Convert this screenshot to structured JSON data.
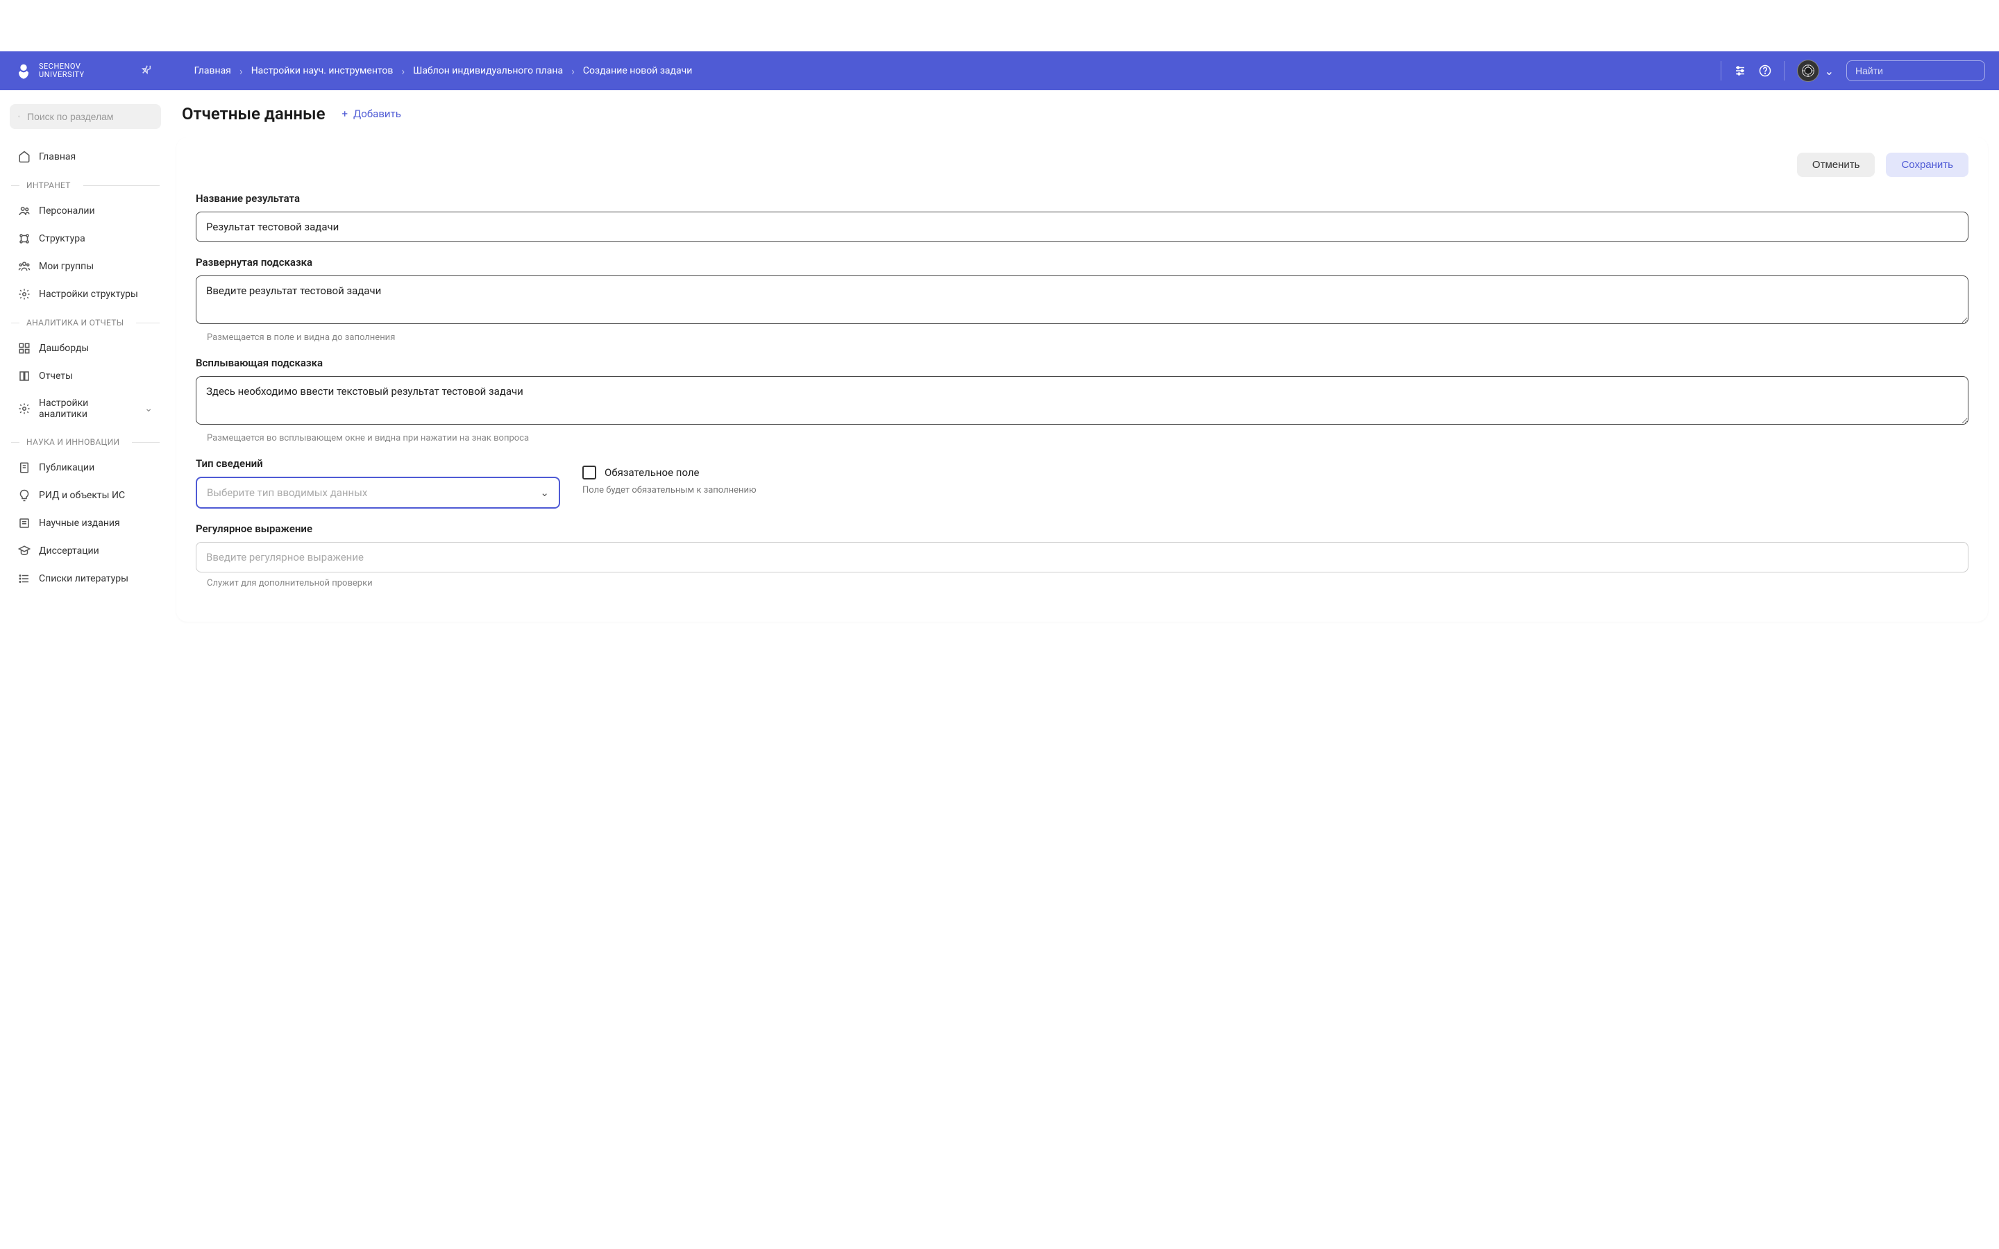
{
  "logo": {
    "line1": "SECHENOV",
    "line2": "UNIVERSITY"
  },
  "breadcrumbs": [
    "Главная",
    "Настройки науч. инструментов",
    "Шаблон индивидуального плана",
    "Создание новой задачи"
  ],
  "header_search_placeholder": "Найти",
  "sidebar_search_placeholder": "Поиск по разделам",
  "nav": {
    "home": "Главная",
    "sections": [
      {
        "title": "ИНТРАНЕТ",
        "items": [
          "Персоналии",
          "Структура",
          "Мои группы",
          "Настройки структуры"
        ]
      },
      {
        "title": "АНАЛИТИКА И ОТЧЕТЫ",
        "items": [
          "Дашборды",
          "Отчеты",
          "Настройки аналитики"
        ]
      },
      {
        "title": "НАУКА И ИННОВАЦИИ",
        "items": [
          "Публикации",
          "РИД и объекты ИС",
          "Научные издания",
          "Диссертации",
          "Списки литературы"
        ]
      }
    ]
  },
  "page": {
    "title": "Отчетные данные",
    "add_button": "Добавить",
    "cancel": "Отменить",
    "save": "Сохранить"
  },
  "form": {
    "result_name": {
      "label": "Название результата",
      "value": "Результат тестовой задачи"
    },
    "expanded_hint": {
      "label": "Развернутая подсказка",
      "value": "Введите результат тестовой задачи",
      "hint": "Размещается в поле и видна до заполнения"
    },
    "popup_hint": {
      "label": "Всплывающая подсказка",
      "value": "Здесь необходимо ввести текстовый результат тестовой задачи",
      "hint": "Размещается во всплывающем окне и видна при нажатии на знак вопроса"
    },
    "data_type": {
      "label": "Тип сведений",
      "placeholder": "Выберите тип вводимых данных"
    },
    "required": {
      "label": "Обязательное поле",
      "hint": "Поле будет обязательным к заполнению"
    },
    "regex": {
      "label": "Регулярное выражение",
      "placeholder": "Введите регулярное выражение",
      "hint": "Служит для дополнительной проверки"
    }
  }
}
